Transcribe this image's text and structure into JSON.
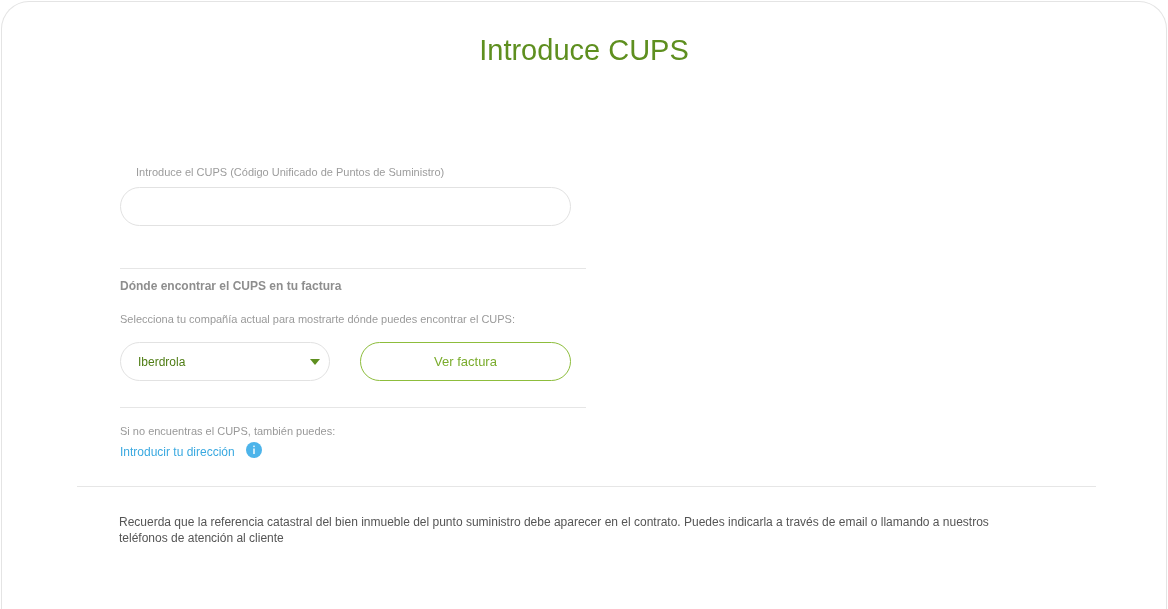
{
  "title": "Introduce CUPS",
  "cups_field": {
    "label": "Introduce el CUPS (Código Unificado de Puntos de Suministro)"
  },
  "invoice_help": {
    "heading": "Dónde encontrar el CUPS en tu factura",
    "instruction": "Selecciona tu compañía actual para mostrarte dónde puedes encontrar el CUPS:",
    "company_select": {
      "value": "Iberdrola"
    },
    "button": "Ver factura"
  },
  "alternative": {
    "text": "Si no encuentras el CUPS, también puedes:",
    "link": "Introducir tu dirección"
  },
  "note": "Recuerda que la referencia catastral del bien inmueble del punto suministro debe aparecer en el contrato. Puedes indicarla a través de email o llamando a nuestros teléfonos de atención al cliente"
}
